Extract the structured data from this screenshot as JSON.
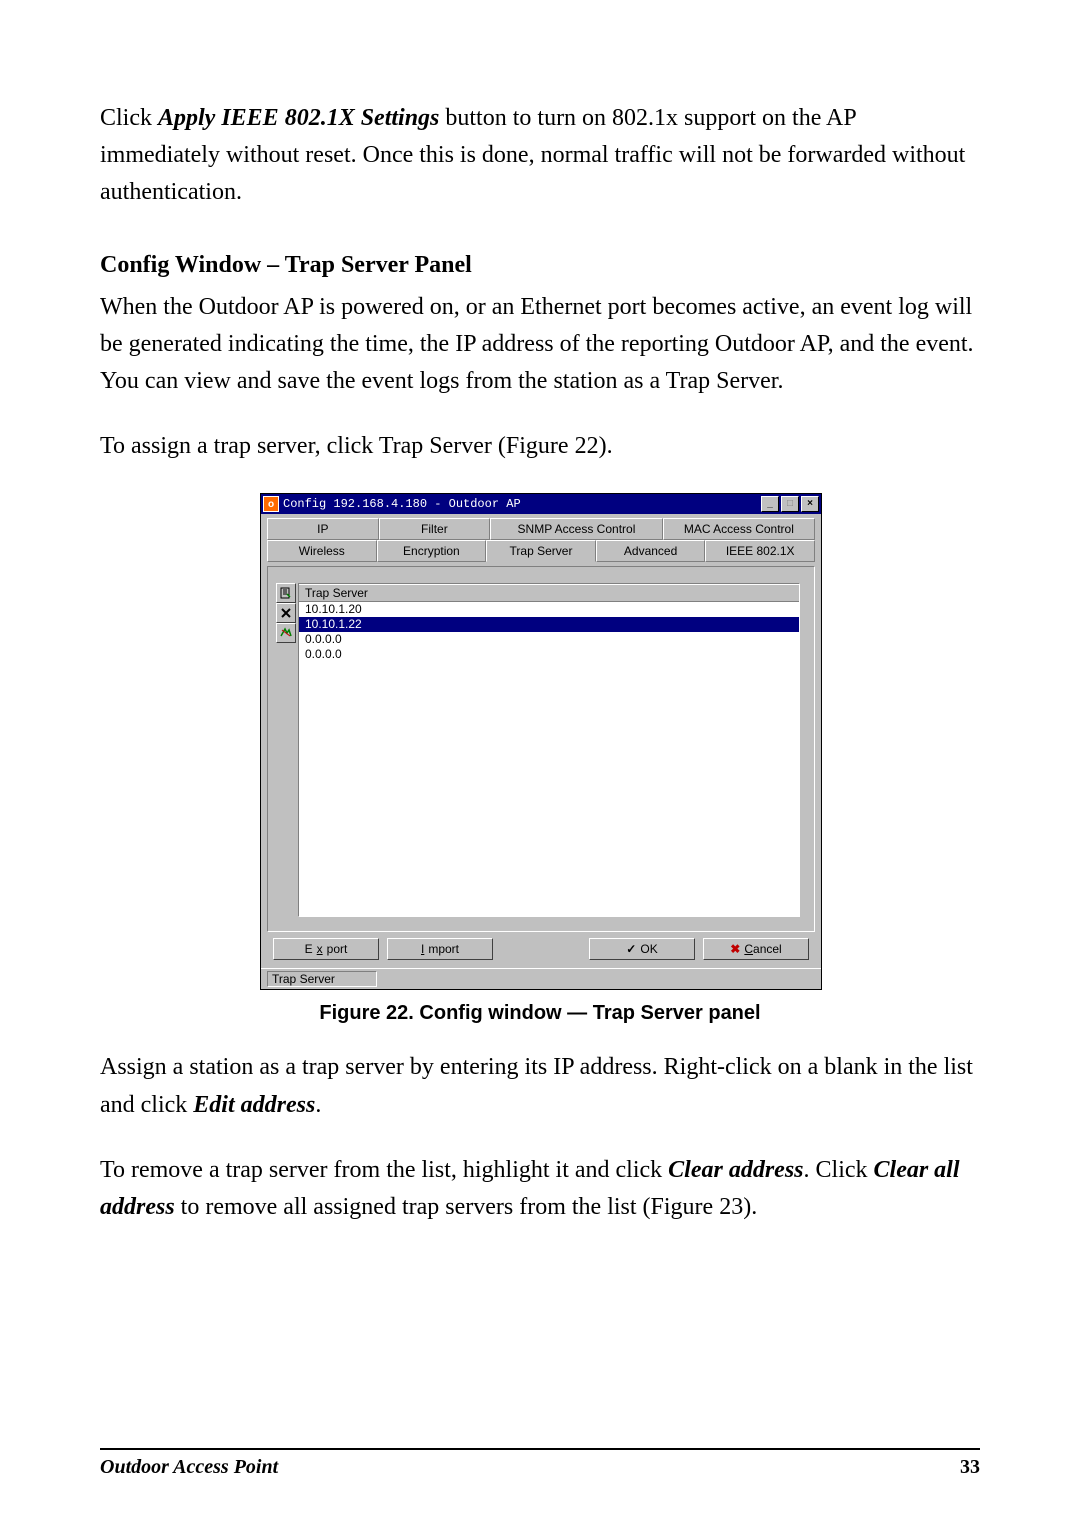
{
  "para1": {
    "pre": "Click ",
    "apply": "Apply IEEE 802.1X Settings",
    "post": " button to turn on 802.1x support on the AP immediately without reset. Once this is done, normal traffic will not be forwarded without authentication."
  },
  "section_heading": "Config Window – Trap Server Panel",
  "para2": "When the Outdoor AP is powered on, or an Ethernet port becomes active, an event log will be generated indicating the time, the IP address of the reporting Outdoor AP, and the event. You can view and save the event logs from the station as a Trap Server.",
  "para3": "To assign a trap server, click Trap Server (Figure 22).",
  "figure_caption": "Figure 22.  Config window — Trap Server panel",
  "para4": {
    "a": "Assign a station as a trap server by entering its IP address. Right-click on a blank in the list and click ",
    "edit": "Edit address",
    "b": "."
  },
  "para5": {
    "a": "To remove a trap server from the list, highlight it and click ",
    "clear": "Clear address",
    "b": ". Click ",
    "clearall": "Clear all address",
    "c": " to remove all assigned trap servers from the list (Figure 23)."
  },
  "footer": {
    "title": "Outdoor Access Point",
    "page": "33"
  },
  "window": {
    "title": "Config 192.168.4.180 - Outdoor AP",
    "icon_letter": "o",
    "controls": {
      "min": "_",
      "max": "□",
      "close": "×"
    },
    "tabs_row1": [
      "IP",
      "Filter",
      "SNMP Access Control",
      "MAC Access Control"
    ],
    "tabs_row2": [
      "Wireless",
      "Encryption",
      "Trap Server",
      "Advanced",
      "IEEE 802.1X"
    ],
    "active_tab": "Trap Server",
    "list_header": "Trap Server",
    "list_items": [
      "10.10.1.20",
      "10.10.1.22",
      "0.0.0.0",
      "0.0.0.0"
    ],
    "selected_index": 1,
    "toolbar_icons": [
      "edit-address-icon",
      "clear-address-icon",
      "clear-all-addresses-icon"
    ],
    "buttons": {
      "export_pre": "E",
      "export_ul": "x",
      "export_post": "port",
      "import_ul": "I",
      "import_post": "mport",
      "ok": "OK",
      "cancel_ul": "C",
      "cancel_post": "ancel"
    },
    "status": "Trap Server"
  }
}
